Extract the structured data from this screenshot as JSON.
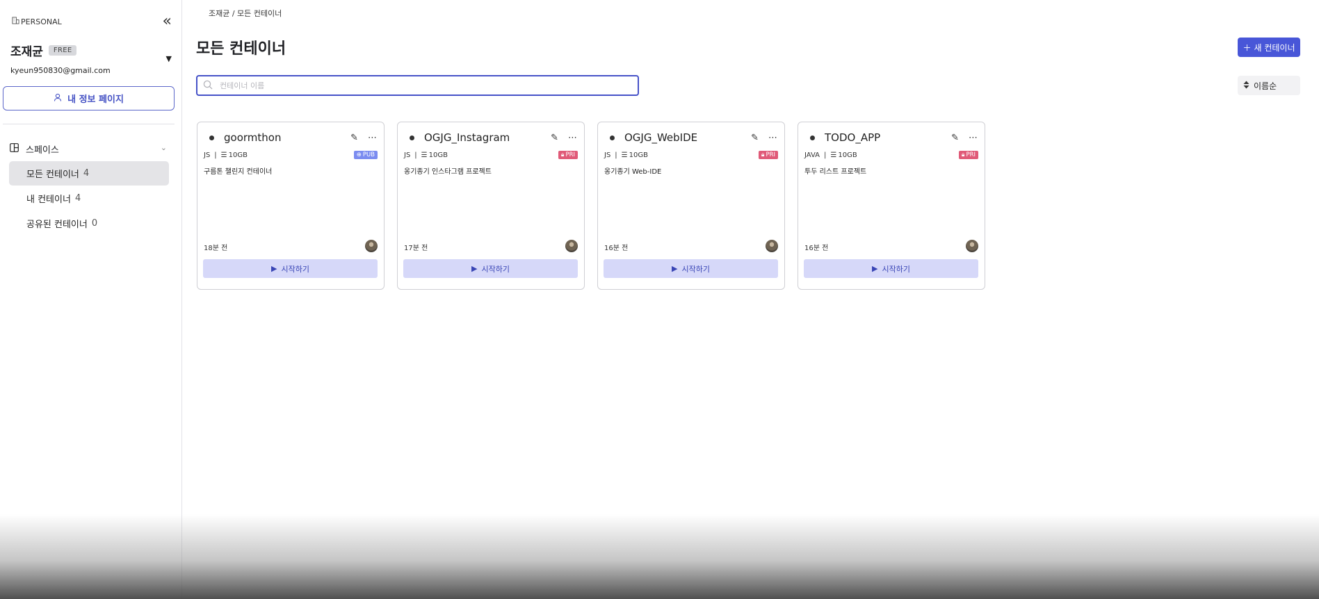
{
  "sidebar": {
    "brand": "PERSONAL",
    "user": {
      "name": "조재균",
      "plan": "FREE",
      "email": "kyeun950830@gmail.com"
    },
    "profile_button": "내 정보 페이지",
    "section_title": "스페이스",
    "nav": [
      {
        "label": "모든 컨테이너",
        "count": "4",
        "active": true
      },
      {
        "label": "내 컨테이너",
        "count": "4",
        "active": false
      },
      {
        "label": "공유된 컨테이너",
        "count": "0",
        "active": false
      }
    ]
  },
  "header": {
    "breadcrumb": "조재균 / 모든 컨테이너",
    "title": "모든 컨테이너",
    "new_button": "새 컨테이너"
  },
  "search": {
    "placeholder": "컨테이너 이름",
    "value": ""
  },
  "sort": {
    "label": "이름순"
  },
  "start_label": "시작하기",
  "containers": [
    {
      "name": "goormthon",
      "lang": "JS",
      "storage": "10GB",
      "visibility": "PUB",
      "visibility_color": "#7b8cf0",
      "description": "구름톤 챌린지 컨테이너",
      "time": "18분 전"
    },
    {
      "name": "OGJG_Instagram",
      "lang": "JS",
      "storage": "10GB",
      "visibility": "PRI",
      "visibility_color": "#e05a78",
      "description": "옹기종기 인스타그램 프로젝트",
      "time": "17분 전"
    },
    {
      "name": "OGJG_WebIDE",
      "lang": "JS",
      "storage": "10GB",
      "visibility": "PRI",
      "visibility_color": "#e05a78",
      "description": "옹기종기 Web-IDE",
      "time": "16분 전"
    },
    {
      "name": "TODO_APP",
      "lang": "JAVA",
      "storage": "10GB",
      "visibility": "PRI",
      "visibility_color": "#e05a78",
      "description": "투두 리스트 프로젝트",
      "time": "16분 전"
    }
  ]
}
